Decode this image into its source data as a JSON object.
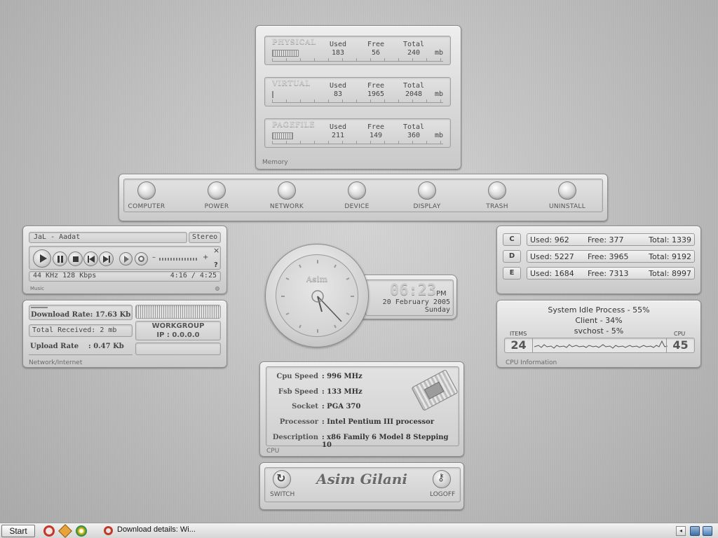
{
  "memory": {
    "caption": "Memory",
    "headers": [
      "Used",
      "Free",
      "Total"
    ],
    "unit": "mb",
    "rows": [
      {
        "label": "PHYSICAL",
        "used": "183",
        "free": "56",
        "total": "240",
        "usage": 0.76
      },
      {
        "label": "VIRTUAL",
        "used": "83",
        "free": "1965",
        "total": "2048",
        "usage": 0.04
      },
      {
        "label": "PAGEFILE",
        "used": "211",
        "free": "149",
        "total": "360",
        "usage": 0.59
      }
    ]
  },
  "launcher": {
    "items": [
      {
        "label": "COMPUTER"
      },
      {
        "label": "POWER"
      },
      {
        "label": "NETWORK"
      },
      {
        "label": "DEVICE"
      },
      {
        "label": "DISPLAY"
      },
      {
        "label": "TRASH"
      },
      {
        "label": "UNINSTALL"
      }
    ]
  },
  "player": {
    "track": "JaL - Aadat",
    "mode": "Stereo",
    "quality": "44 KHz 128 Kbps",
    "time": "4:16 / 4:25",
    "caption": "Music",
    "help": "?",
    "close": "×",
    "vol_minus": "–",
    "vol_plus": "+"
  },
  "network": {
    "download": "Download Rate: 17.63 Kb",
    "received": "Total Received: 2 mb",
    "upload": "Upload Rate    : 0.47 Kb",
    "workgroup": "WORKGROUP",
    "ip": "IP : 0.0.0.0",
    "caption": "Network/Internet"
  },
  "clock": {
    "owner": "Asim",
    "time": "06:23",
    "ampm": "PM",
    "date": "20 February 2005",
    "day": "Sunday"
  },
  "drives": [
    {
      "letter": "C",
      "used": "Used: 962",
      "free": "Free: 377",
      "total": "Total: 1339"
    },
    {
      "letter": "D",
      "used": "Used: 5227",
      "free": "Free: 3965",
      "total": "Total: 9192"
    },
    {
      "letter": "E",
      "used": "Used: 1684",
      "free": "Free: 7313",
      "total": "Total: 8997"
    }
  ],
  "cpu_info": {
    "process1": "System Idle Process - 55%",
    "process2": "Client - 34%",
    "process3": "svchost - 5%",
    "items_label": "ITEMS",
    "items_value": "24",
    "cpu_label": "CPU",
    "cpu_value": "45",
    "caption": "CPU Information"
  },
  "cpu": {
    "caption": "CPU",
    "rows": [
      {
        "label": "Cpu Speed",
        "value": ": 996 MHz"
      },
      {
        "label": "Fsb Speed",
        "value": ": 133 MHz"
      },
      {
        "label": "Socket",
        "value": ": PGA 370"
      },
      {
        "label": "Processor",
        "value": ": Intel Pentium III processor"
      },
      {
        "label": "Description",
        "value": ": x86 Family 6 Model 8 Stepping 10"
      }
    ]
  },
  "user": {
    "name": "Asim Gilani",
    "switch_label": "SWITCH",
    "logoff_label": "LOGOFF"
  },
  "taskbar": {
    "start_label": "Start",
    "task_label": "Download details: Wi..."
  }
}
